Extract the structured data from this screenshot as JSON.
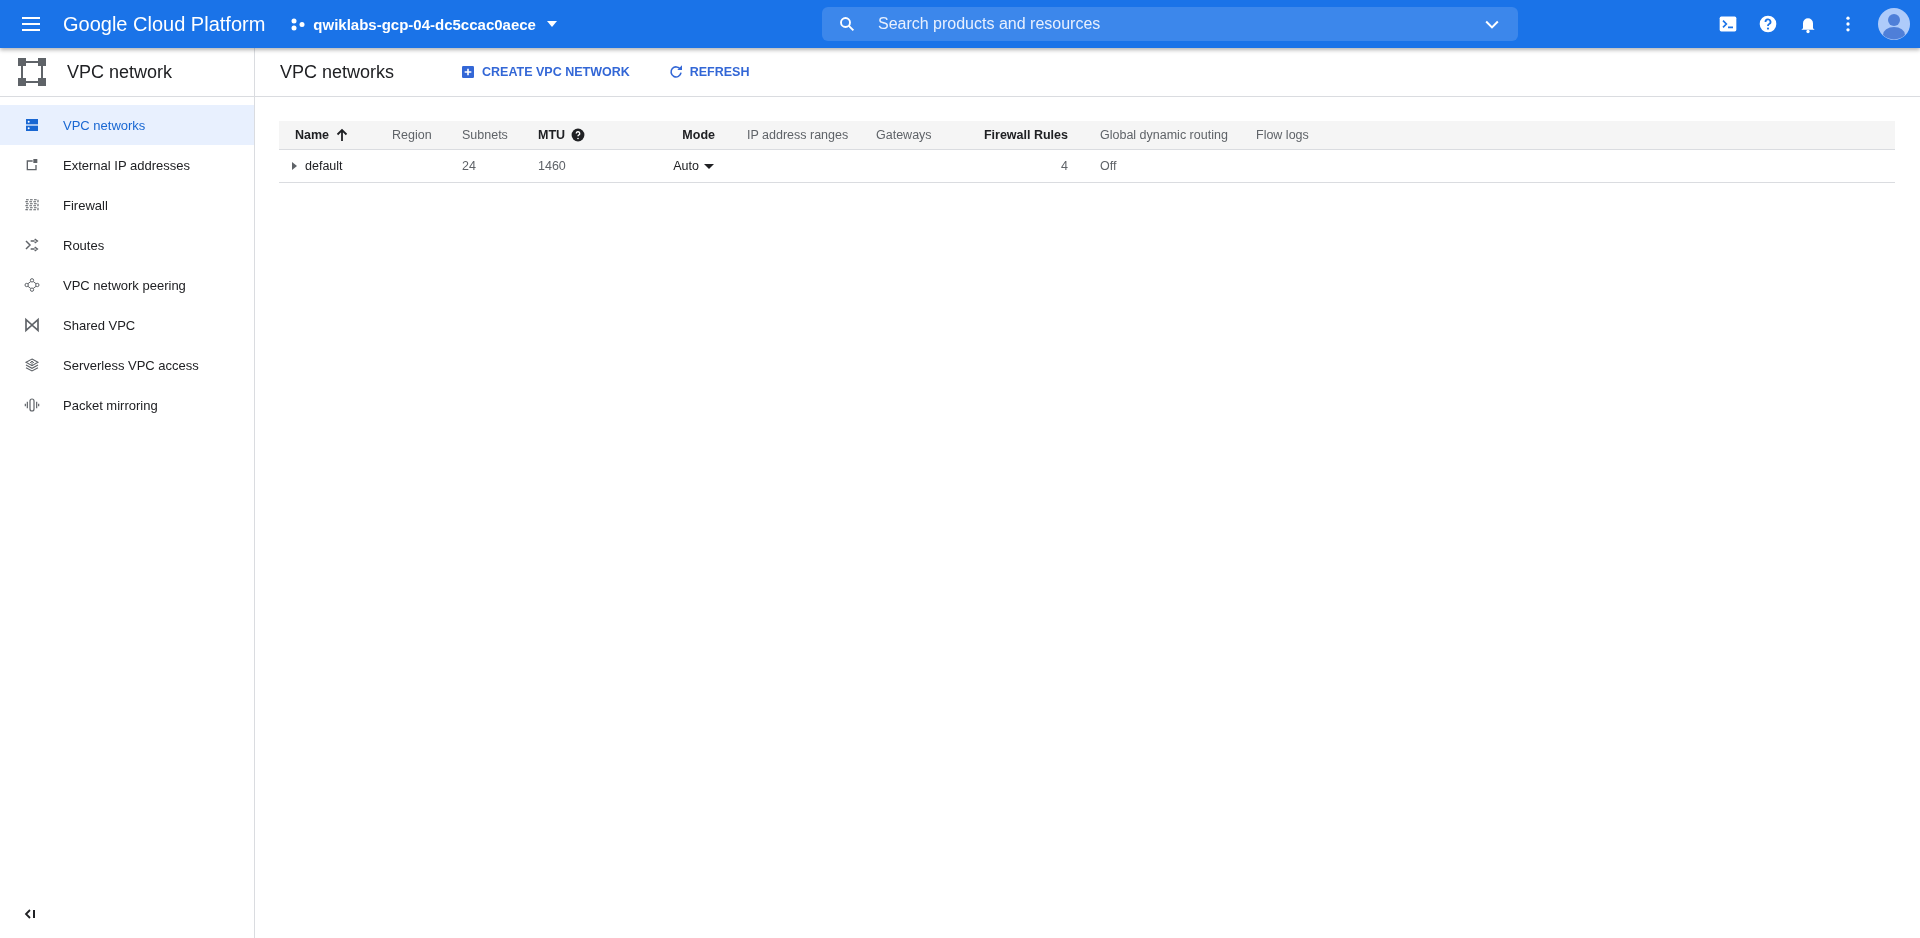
{
  "topbar": {
    "product": "Google Cloud Platform",
    "project": "qwiklabs-gcp-04-dc5ccac0aece",
    "search": {
      "placeholder": "Search products and resources"
    }
  },
  "sidebar": {
    "title": "VPC network",
    "items": [
      {
        "label": "VPC networks",
        "selected": true
      },
      {
        "label": "External IP addresses",
        "selected": false
      },
      {
        "label": "Firewall",
        "selected": false
      },
      {
        "label": "Routes",
        "selected": false
      },
      {
        "label": "VPC network peering",
        "selected": false
      },
      {
        "label": "Shared VPC",
        "selected": false
      },
      {
        "label": "Serverless VPC access",
        "selected": false
      },
      {
        "label": "Packet mirroring",
        "selected": false
      }
    ]
  },
  "page": {
    "title": "VPC networks",
    "actions": [
      {
        "label": "CREATE VPC NETWORK"
      },
      {
        "label": "REFRESH"
      }
    ]
  },
  "table": {
    "columns": [
      {
        "label": "Name",
        "emphasized": true,
        "sorted": true,
        "help": false
      },
      {
        "label": "Region",
        "emphasized": false,
        "sorted": false,
        "help": false
      },
      {
        "label": "Subnets",
        "emphasized": false,
        "sorted": false,
        "help": false
      },
      {
        "label": "MTU",
        "emphasized": true,
        "sorted": false,
        "help": true
      },
      {
        "label": "Mode",
        "emphasized": true,
        "sorted": false,
        "help": false
      },
      {
        "label": "IP address ranges",
        "emphasized": false,
        "sorted": false,
        "help": false
      },
      {
        "label": "Gateways",
        "emphasized": false,
        "sorted": false,
        "help": false
      },
      {
        "label": "Firewall Rules",
        "emphasized": true,
        "sorted": false,
        "help": false
      },
      {
        "label": "Global dynamic routing",
        "emphasized": false,
        "sorted": false,
        "help": false
      },
      {
        "label": "Flow logs",
        "emphasized": false,
        "sorted": false,
        "help": false
      }
    ],
    "rows": [
      {
        "expanded": false,
        "cells": [
          "default",
          "",
          "24",
          "1460",
          "Auto",
          "",
          "",
          "4",
          "Off",
          ""
        ]
      }
    ]
  }
}
